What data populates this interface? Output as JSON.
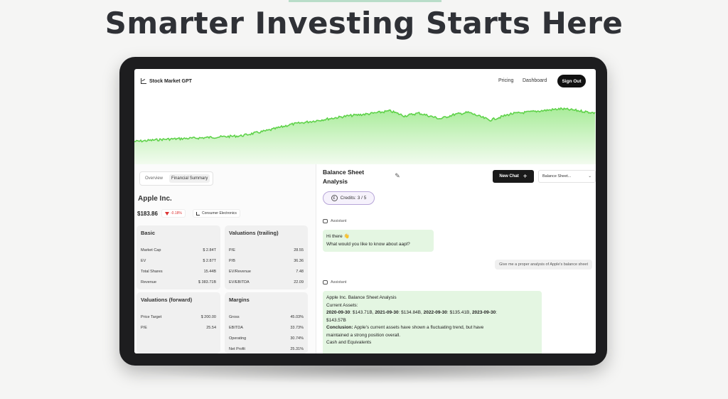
{
  "headline": "Smarter Investing Starts Here",
  "nav": {
    "brand": "Stock Market GPT",
    "links": [
      "Pricing",
      "Dashboard"
    ],
    "signout": "Sign Out"
  },
  "colors": {
    "accent_green": "#7ee36b",
    "assistant_bubble": "#e4f6e2",
    "credits_border": "#b7a6d8",
    "negative": "#d33333"
  },
  "stock": {
    "tabs": [
      "Overview",
      "Financial Summary"
    ],
    "company": "Apple Inc.",
    "price": "$183.86",
    "change": "-0.18%",
    "sector": "Consumer Electronics"
  },
  "cards": {
    "basic": {
      "title": "Basic",
      "rows": [
        {
          "label": "Market Cap",
          "value": "$ 2.84T"
        },
        {
          "label": "EV",
          "value": "$ 2.87T"
        },
        {
          "label": "Total Shares",
          "value": "15.44B"
        },
        {
          "label": "Revenue",
          "value": "$ 383.71B"
        }
      ]
    },
    "valuations_trailing": {
      "title": "Valuations (trailing)",
      "rows": [
        {
          "label": "P/E",
          "value": "28.55"
        },
        {
          "label": "P/B",
          "value": "36.36"
        },
        {
          "label": "EV/Revenue",
          "value": "7.48"
        },
        {
          "label": "EV/EBITDA",
          "value": "22.09"
        }
      ]
    },
    "valuations_forward": {
      "title": "Valuations (forward)",
      "rows": [
        {
          "label": "Price Target",
          "value": "$ 200.00"
        },
        {
          "label": "P/E",
          "value": "25.54"
        }
      ]
    },
    "margins": {
      "title": "Margins",
      "rows": [
        {
          "label": "Gross",
          "value": "45.03%"
        },
        {
          "label": "EBITDA",
          "value": "33.73%"
        },
        {
          "label": "Operating",
          "value": "30.74%"
        },
        {
          "label": "Net Profit",
          "value": "25.31%"
        }
      ]
    }
  },
  "chat": {
    "title": "Balance Sheet Analysis",
    "new_chat": "New Chat",
    "select_value": "Balance Sheet...",
    "credits": "Credits: 3 / 5",
    "role_assistant": "Assistant",
    "msg1_line1": "Hi there 👋",
    "msg1_line2": "What would you like to know about aapl?",
    "user_msg": "Give me a proper analysis of Apple's balance sheet",
    "msg2": {
      "line1": "Apple Inc. Balance Sheet Analysis",
      "line2": "Current Assets:",
      "d1": "2020-09-30",
      "v1": ": $143.71B,",
      "d2": "2021-09-30",
      "v2": ": $134.84B,",
      "d3": "2022-09-30",
      "v3": ": $135.41B,",
      "d4": "2023-09-30",
      "v4": ":",
      "v5": "$143.57B",
      "conclusion_label": "Conclusion:",
      "conclusion_a": " Apple's current assets have shown a fluctuating trend, but have",
      "conclusion_b": "maintained a strong position overall.",
      "line_last": "Cash and Equivalents"
    }
  }
}
